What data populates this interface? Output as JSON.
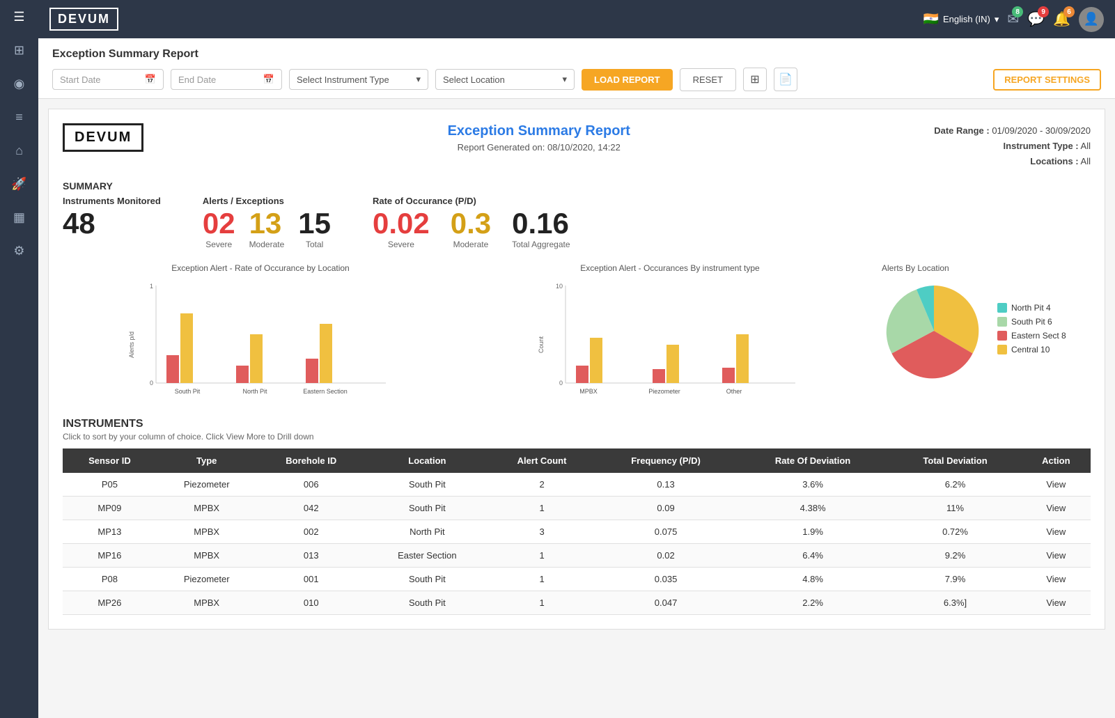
{
  "app": {
    "name": "DEVUM",
    "logo_text": "DEVUM"
  },
  "topnav": {
    "language": "English (IN)",
    "mail_badge": "8",
    "chat_badge": "9",
    "bell_badge": "6"
  },
  "sidebar": {
    "icons": [
      "menu",
      "grid",
      "palette",
      "list",
      "home",
      "rocket",
      "chart-bar",
      "gear"
    ]
  },
  "report_header": {
    "title": "Exception Summary Report",
    "start_date_placeholder": "Start Date",
    "end_date_placeholder": "End Date",
    "instrument_type_placeholder": "Select Instrument Type",
    "location_placeholder": "Select Location",
    "load_btn": "LOAD REPORT",
    "reset_btn": "RESET",
    "settings_btn": "REPORT SETTINGS"
  },
  "report": {
    "logo_text": "DEVUM",
    "main_title": "Exception Summary Report",
    "generated": "Report Generated on: 08/10/2020, 14:22",
    "date_range_label": "Date Range :",
    "date_range_value": "01/09/2020 - 30/09/2020",
    "instrument_type_label": "Instrument Type :",
    "instrument_type_value": "All",
    "locations_label": "Locations :",
    "locations_value": "All",
    "summary_label": "SUMMARY",
    "instruments_monitored_label": "Instruments Monitored",
    "instruments_monitored_value": "48",
    "alerts_label": "Alerts / Exceptions",
    "alerts_severe_value": "02",
    "alerts_severe_label": "Severe",
    "alerts_moderate_value": "13",
    "alerts_moderate_label": "Moderate",
    "alerts_total_value": "15",
    "alerts_total_label": "Total",
    "rate_label": "Rate of Occurance (P/D)",
    "rate_severe_value": "0.02",
    "rate_severe_label": "Severe",
    "rate_moderate_value": "0.3",
    "rate_moderate_label": "Moderate",
    "rate_aggregate_value": "0.16",
    "rate_aggregate_label": "Total Aggregate",
    "chart1_title": "Exception Alert - Rate of Occurance by Location",
    "chart1_y_label": "Alerts p/d",
    "chart1_x_labels": [
      "South Pit",
      "North Pit",
      "Eastern Section"
    ],
    "chart2_title": "Exception Alert - Occurances By instrument type",
    "chart2_y_label": "Count",
    "chart2_x_labels": [
      "MPBX",
      "Piezometer",
      "Other"
    ],
    "pie_title": "Alerts By Location",
    "pie_data": [
      {
        "label": "North Pit",
        "value": 4,
        "color": "#4ecdc4"
      },
      {
        "label": "South Pit",
        "value": 6,
        "color": "#a8d8a8"
      },
      {
        "label": "Eastern Sect",
        "value": 8,
        "color": "#e05c5c"
      },
      {
        "label": "Central",
        "value": 10,
        "color": "#f0c040"
      }
    ],
    "instruments_title": "INSTRUMENTS",
    "instruments_subtitle": "Click to sort by your column of choice. Click View More to Drill down",
    "table_headers": [
      "Sensor ID",
      "Type",
      "Borehole ID",
      "Location",
      "Alert Count",
      "Frequency (P/D)",
      "Rate Of Deviation",
      "Total Deviation",
      "Action"
    ],
    "table_rows": [
      {
        "sensor_id": "P05",
        "type": "Piezometer",
        "borehole": "006",
        "location": "South Pit",
        "alert_count": "2",
        "frequency": "0.13",
        "rate_deviation": "3.6%",
        "total_deviation": "6.2%",
        "action": "View",
        "type_class": "piezometer"
      },
      {
        "sensor_id": "MP09",
        "type": "MPBX",
        "borehole": "042",
        "location": "South Pit",
        "alert_count": "1",
        "frequency": "0.09",
        "rate_deviation": "4.38%",
        "total_deviation": "11%",
        "action": "View",
        "type_class": "mpbx"
      },
      {
        "sensor_id": "MP13",
        "type": "MPBX",
        "borehole": "002",
        "location": "North Pit",
        "alert_count": "3",
        "frequency": "0.075",
        "rate_deviation": "1.9%",
        "total_deviation": "0.72%",
        "action": "View",
        "type_class": "mpbx"
      },
      {
        "sensor_id": "MP16",
        "type": "MPBX",
        "borehole": "013",
        "location": "Easter Section",
        "alert_count": "1",
        "frequency": "0.02",
        "rate_deviation": "6.4%",
        "total_deviation": "9.2%",
        "action": "View",
        "type_class": "mpbx"
      },
      {
        "sensor_id": "P08",
        "type": "Piezometer",
        "borehole": "001",
        "location": "South Pit",
        "alert_count": "1",
        "frequency": "0.035",
        "rate_deviation": "4.8%",
        "total_deviation": "7.9%",
        "action": "View",
        "type_class": "piezometer"
      },
      {
        "sensor_id": "MP26",
        "type": "MPBX",
        "borehole": "010",
        "location": "South Pit",
        "alert_count": "1",
        "frequency": "0.047",
        "rate_deviation": "2.2%",
        "total_deviation": "6.3%]",
        "action": "View",
        "type_class": "mpbx"
      }
    ]
  }
}
